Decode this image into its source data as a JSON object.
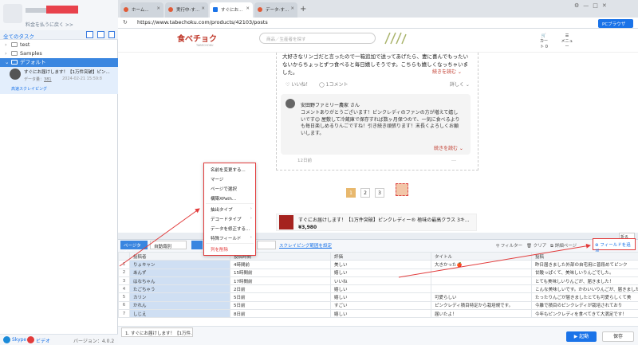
{
  "left": {
    "plan_link": "料金を払うに戻く >>",
    "all_tasks": "全てのタスク",
    "tree": [
      "test",
      "Samples",
      "デフォルト"
    ],
    "task": {
      "title": "すぐにお届けします！【1万件突破】ピン...",
      "data_label": "データ量：",
      "data_count": "381",
      "date": "2024-02-21 15:59:8",
      "mode": "高速スクレイピング"
    },
    "footer": {
      "skype": "Skype",
      "video": "ビデオ",
      "version": "バージョン：4.0.2"
    }
  },
  "browser": {
    "tabs": [
      "ホーム...",
      "実行中-す...",
      "すぐにお...",
      "データ-す..."
    ],
    "url": "https://www.tabechoku.com/products/42103/posts",
    "pc_button": "PCブラウザ"
  },
  "page": {
    "logo": "食べチョク",
    "logo_sub": "TABECHOKU",
    "search_placeholder": "商品／生産者を探す",
    "cart": "カート 0",
    "menu": "メニュー",
    "review": "大好きなリンゴだと言ったので一箱追加で送ってあげたら、妻に喜んでもったいないからちょっとずつ食べると毎日嬉しそうです。こちらも嬉しくなっちゃいました。",
    "more": "続きを読む ⌄",
    "likes": "♡ いいね！",
    "comments": "◯ 1コメント",
    "report": "詳しく ⌄",
    "shop": "安田野ファミリー農家 さん",
    "reply": "コメントありがとうございます！ピンクレディのファンの方が増えて嬉しいです😊 屋敷して冷蔵庫で保存すれば数ヶ月保つので、一気に食べるよりも毎日楽しめるりんごですね！引き続き頑張ります！末長くよろしくお願いします。",
    "reply_date": "12日前",
    "reply_report": "…",
    "pages": [
      "1",
      "2",
      "3",
      "…"
    ],
    "product_name": "すぐにお届けします！【1万件突破】ピンクレディー® 極味の最高クラス 3キ...",
    "product_price": "¥3,980"
  },
  "context_menu": [
    "名前を変更する...",
    "マージ",
    "ページで選択",
    "構築XPath...",
    "抽出タイプ",
    "デコードタイプ",
    "データを修正する...",
    "特殊フィールド",
    "列を削除"
  ],
  "toolbar": {
    "page_type": "ページタイプ",
    "auto_read": "自動識別",
    "scope": "スクレイピング範囲を設定",
    "filter": "フィルター",
    "clear": "クリア",
    "detail": "詳細ページ",
    "add_field": "フィールドを追加",
    "collapse": "折る"
  },
  "table": {
    "headers": [
      "投稿者",
      "投稿時間",
      "評価",
      "タイトル",
      "投稿"
    ],
    "rows": [
      [
        "りょキャン",
        "4時間前",
        "美しい",
        "大きかった🍎",
        "昨日届きました外部の自宅用に普段めてピンク"
      ],
      [
        "あんず",
        "15時間前",
        "嬉しい",
        "",
        "甘酸っぱくて、美味しいりんごでした。"
      ],
      [
        "はなちゃん",
        "17時間前",
        "いいね",
        "",
        "とても美味しいりんごが、届きました！"
      ],
      [
        "たごちゃう",
        "2日前",
        "嬉しい",
        "",
        "こんな美味しいです。かわいいりんごが、届きました。"
      ],
      [
        "カリン",
        "5日前",
        "嬉しい",
        "可愛らしい",
        "たったりんごが届きましたとても可愛らしくて美"
      ],
      [
        "かれん",
        "5日前",
        "すごい",
        "ピンクレディ積目特定から栽培規です。",
        "今離で積目のピンクレディが栽培されており"
      ],
      [
        "しじえ",
        "8日前",
        "嬉しい",
        "届いたよ！",
        "今年もピンクレディを食べてきて大満足です！"
      ]
    ]
  },
  "footer": {
    "current_tab": "1. すぐにお届けします！【1万件...",
    "start": "▶ 起動",
    "save": "保存"
  }
}
